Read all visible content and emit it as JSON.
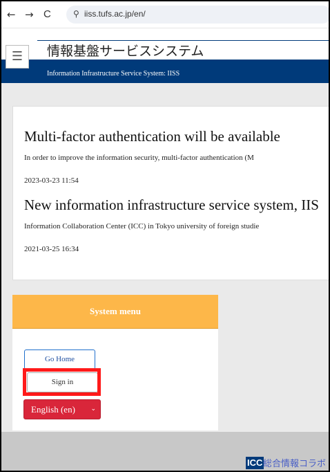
{
  "browser": {
    "url": "iiss.tufs.ac.jp/en/",
    "back_glyph": "←",
    "forward_glyph": "→",
    "reload_glyph": "C",
    "site_info_glyph": "⚲"
  },
  "header": {
    "title_jp": "情報基盤サービスシステム",
    "title_en": "Information Infrastructure Service System: IISS",
    "menu_glyph": "☰"
  },
  "news": [
    {
      "title": "Multi-factor authentication will be available",
      "body": "In order to improve the information security, multi-factor authentication (M",
      "date": "2023-03-23 11:54"
    },
    {
      "title": "New information infrastructure service system, IIS",
      "body": "Information Collaboration Center (ICC) in Tokyo university of foreign studie",
      "date": "2021-03-25 16:34"
    }
  ],
  "system_menu": {
    "title": "System menu",
    "go_home_label": "Go Home",
    "sign_in_label": "Sign in",
    "language_label": "English (en)",
    "language_caret": "⌄"
  },
  "footer": {
    "logo_text": "ICC",
    "org_text": "総合情報コラボ"
  },
  "colors": {
    "header_blue": "#003a7a",
    "menu_orange": "#fdb749",
    "language_red": "#d9263a",
    "highlight_red": "#ff1a1a"
  }
}
